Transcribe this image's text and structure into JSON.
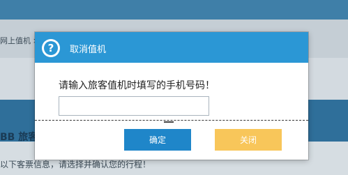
{
  "background": {
    "breadcrumb": "网上值机 >",
    "heading": "BB  旅客",
    "notice": "以下客票信息，请选择并确认您的行程！"
  },
  "dialog": {
    "title": "取消值机",
    "help_icon": "question-circle-icon",
    "prompt": "请输入旅客值机时填写的手机号码！",
    "phone_value": "",
    "phone_placeholder": "",
    "confirm_label": "确定",
    "close_label": "关闭"
  },
  "colors": {
    "header_blue": "#2b97d5",
    "confirm_blue": "#1f86c9",
    "close_yellow": "#f8c65a"
  }
}
